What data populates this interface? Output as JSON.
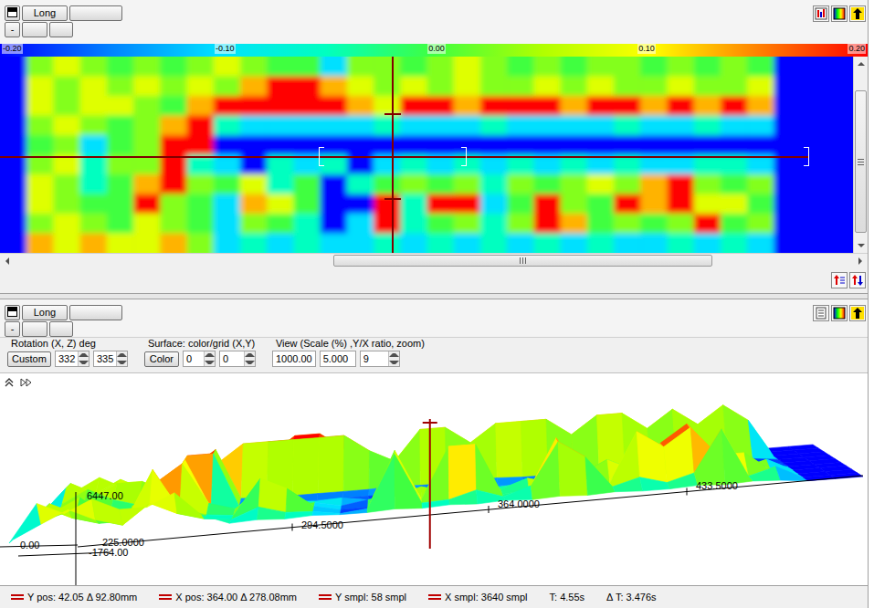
{
  "top_panel": {
    "toolbar": {
      "row1": [
        {
          "kind": "icon",
          "label": ""
        },
        {
          "kind": "text",
          "label": "Long"
        },
        {
          "kind": "text",
          "label": ""
        }
      ],
      "row2": [
        {
          "kind": "text",
          "label": "-"
        },
        {
          "kind": "text",
          "label": ""
        },
        {
          "kind": "text",
          "label": ""
        }
      ]
    },
    "colorbar": {
      "ticks": [
        "-0.20",
        "-0.10",
        "0.00",
        "0.10",
        "0.20"
      ]
    },
    "heatmap": {
      "rows": [
        [
          -0.2,
          0.03,
          0.08,
          0.03,
          0,
          0.03,
          0,
          0.03,
          0.08,
          0.03,
          0,
          0,
          -0.1,
          0.03,
          0.03,
          0,
          0.03,
          0.08,
          0.03,
          0,
          0.03,
          0,
          0.03,
          0.03,
          0,
          0.03,
          0,
          0.03,
          0,
          -0.2,
          -0.2,
          -0.2
        ],
        [
          -0.2,
          0.08,
          0.03,
          0.08,
          0.03,
          0.08,
          0.03,
          0.08,
          0.03,
          0.13,
          0.2,
          0.2,
          0.13,
          0.08,
          0.03,
          0.08,
          0.03,
          0.08,
          0.03,
          0.03,
          0.08,
          0.03,
          0.08,
          0.03,
          0.03,
          0.08,
          0.03,
          0.03,
          0.08,
          -0.2,
          -0.2,
          -0.2
        ],
        [
          -0.2,
          0.08,
          0.03,
          0.08,
          0.08,
          0.03,
          0,
          0.13,
          0.2,
          0.2,
          0.2,
          0.2,
          0.2,
          0.13,
          0.08,
          0.2,
          0.2,
          0.13,
          0.2,
          0.2,
          0.2,
          0.13,
          0.2,
          0.2,
          0.13,
          0.2,
          0.13,
          0.2,
          0.13,
          -0.2,
          -0.2,
          -0.2
        ],
        [
          -0.2,
          0.03,
          0.08,
          0.03,
          0,
          0.03,
          0.13,
          0.2,
          -0.05,
          -0.1,
          -0.1,
          -0.1,
          -0.1,
          -0.1,
          -0.05,
          -0.1,
          -0.1,
          -0.1,
          -0.05,
          -0.1,
          -0.1,
          -0.1,
          -0.1,
          -0.05,
          -0.1,
          -0.1,
          -0.05,
          -0.1,
          -0.1,
          -0.2,
          -0.2,
          -0.2
        ],
        [
          -0.2,
          0,
          0.03,
          -0.1,
          0,
          0.03,
          0.2,
          0.2,
          -0.2,
          -0.2,
          -0.2,
          -0.2,
          -0.2,
          -0.2,
          -0.2,
          -0.2,
          -0.2,
          -0.2,
          -0.2,
          -0.2,
          -0.2,
          -0.2,
          -0.2,
          -0.2,
          -0.2,
          -0.2,
          -0.2,
          -0.2,
          -0.2,
          -0.2,
          -0.2,
          -0.2
        ],
        [
          -0.2,
          0.03,
          0.08,
          -0.05,
          0.03,
          0.03,
          0.2,
          -0.05,
          -0.1,
          -0.2,
          -0.05,
          -0.1,
          -0.05,
          -0.2,
          -0.1,
          -0.05,
          -0.1,
          -0.05,
          -0.1,
          -0.05,
          -0.1,
          -0.05,
          -0.1,
          -0.05,
          -0.1,
          -0.1,
          -0.05,
          -0.05,
          -0.1,
          -0.2,
          -0.2,
          -0.2
        ],
        [
          -0.2,
          0.08,
          0.03,
          -0.05,
          0,
          0.13,
          0.2,
          0.03,
          0,
          0.08,
          -0.05,
          0,
          -0.2,
          -0.05,
          0,
          0.03,
          0,
          0.03,
          -0.05,
          0.03,
          0,
          0.03,
          0.08,
          0.03,
          0.13,
          0.2,
          0.03,
          0,
          0.03,
          -0.2,
          -0.2,
          -0.2
        ],
        [
          -0.2,
          0.08,
          0.03,
          0,
          0,
          0.2,
          0.03,
          0,
          -0.1,
          0.13,
          0.08,
          0,
          -0.2,
          -0.2,
          0.2,
          -0.05,
          0.2,
          0.2,
          -0.1,
          0,
          0.2,
          0.03,
          0,
          0.2,
          0.13,
          0.2,
          0.08,
          0.08,
          0,
          -0.2,
          -0.2,
          -0.2
        ],
        [
          -0.2,
          0.03,
          0.08,
          0.03,
          0,
          0.08,
          0.03,
          0,
          -0.1,
          0.03,
          0,
          -0.05,
          -0.2,
          -0.1,
          0.2,
          -0.05,
          0,
          0.03,
          -0.05,
          0.03,
          0.2,
          0.13,
          0,
          0.03,
          0,
          0.03,
          0.2,
          0,
          0.03,
          -0.2,
          -0.2,
          -0.2
        ],
        [
          -0.2,
          0.13,
          0.08,
          0.13,
          0.08,
          0.08,
          0.13,
          0.03,
          -0.1,
          -0.05,
          -0.1,
          -0.05,
          -0.1,
          -0.1,
          -0.05,
          -0.1,
          -0.05,
          -0.1,
          -0.05,
          -0.1,
          -0.05,
          -0.1,
          -0.05,
          -0.1,
          -0.1,
          -0.05,
          -0.1,
          -0.05,
          -0.1,
          -0.2,
          -0.2,
          -0.2
        ]
      ]
    },
    "cursor": {
      "x_level": 0.459,
      "y_level": 0.507
    },
    "scroll": {
      "h_start": 0.38,
      "h_size": 0.452,
      "v_start": 0.115,
      "v_size": 0.85
    }
  },
  "bottom_panel": {
    "toolbar": {
      "row1": [
        {
          "kind": "icon",
          "label": ""
        },
        {
          "kind": "text",
          "label": "Long"
        },
        {
          "kind": "text",
          "label": ""
        }
      ],
      "row2": [
        {
          "kind": "text",
          "label": "-"
        },
        {
          "kind": "text",
          "label": ""
        },
        {
          "kind": "text",
          "label": ""
        }
      ]
    },
    "controls": [
      {
        "title": "Rotation (X, Z) deg",
        "button": "Custom",
        "fields": [
          {
            "value": "332",
            "spinner": true
          },
          {
            "value": "335",
            "spinner": true
          }
        ]
      },
      {
        "title": "Surface: color/grid (X,Y)",
        "button": "Color",
        "fields": [
          {
            "value": "0",
            "spinner": true
          },
          {
            "value": "0",
            "spinner": true
          }
        ]
      },
      {
        "title": "View (Scale (%) ,Y/X ratio, zoom)",
        "fields": [
          {
            "value": "1000.00",
            "spinner": false
          },
          {
            "value": "5.000",
            "spinner": false
          },
          {
            "value": "9",
            "spinner": true
          }
        ]
      }
    ],
    "surface_view": {
      "axis_labels": [
        {
          "text": "6447.00"
        },
        {
          "text": "0.00"
        },
        {
          "text": "-1764.00"
        },
        {
          "text": "225.0000"
        },
        {
          "text": "294.5000"
        },
        {
          "text": "364.0000"
        },
        {
          "text": "433.5000"
        }
      ],
      "cursor_x_level": 0.495
    }
  },
  "status_bar": [
    {
      "text": "Y pos: 42.05 Δ 92.80mm",
      "marker": true
    },
    {
      "text": "X pos: 364.00 Δ 278.08mm",
      "marker": true
    },
    {
      "text": "Y smpl: 58 smpl",
      "marker": true
    },
    {
      "text": "X smpl: 3640 smpl",
      "marker": true
    },
    {
      "text": "T: 4.55s",
      "marker": false
    },
    {
      "text": "Δ T: 3.476s",
      "marker": false
    }
  ]
}
